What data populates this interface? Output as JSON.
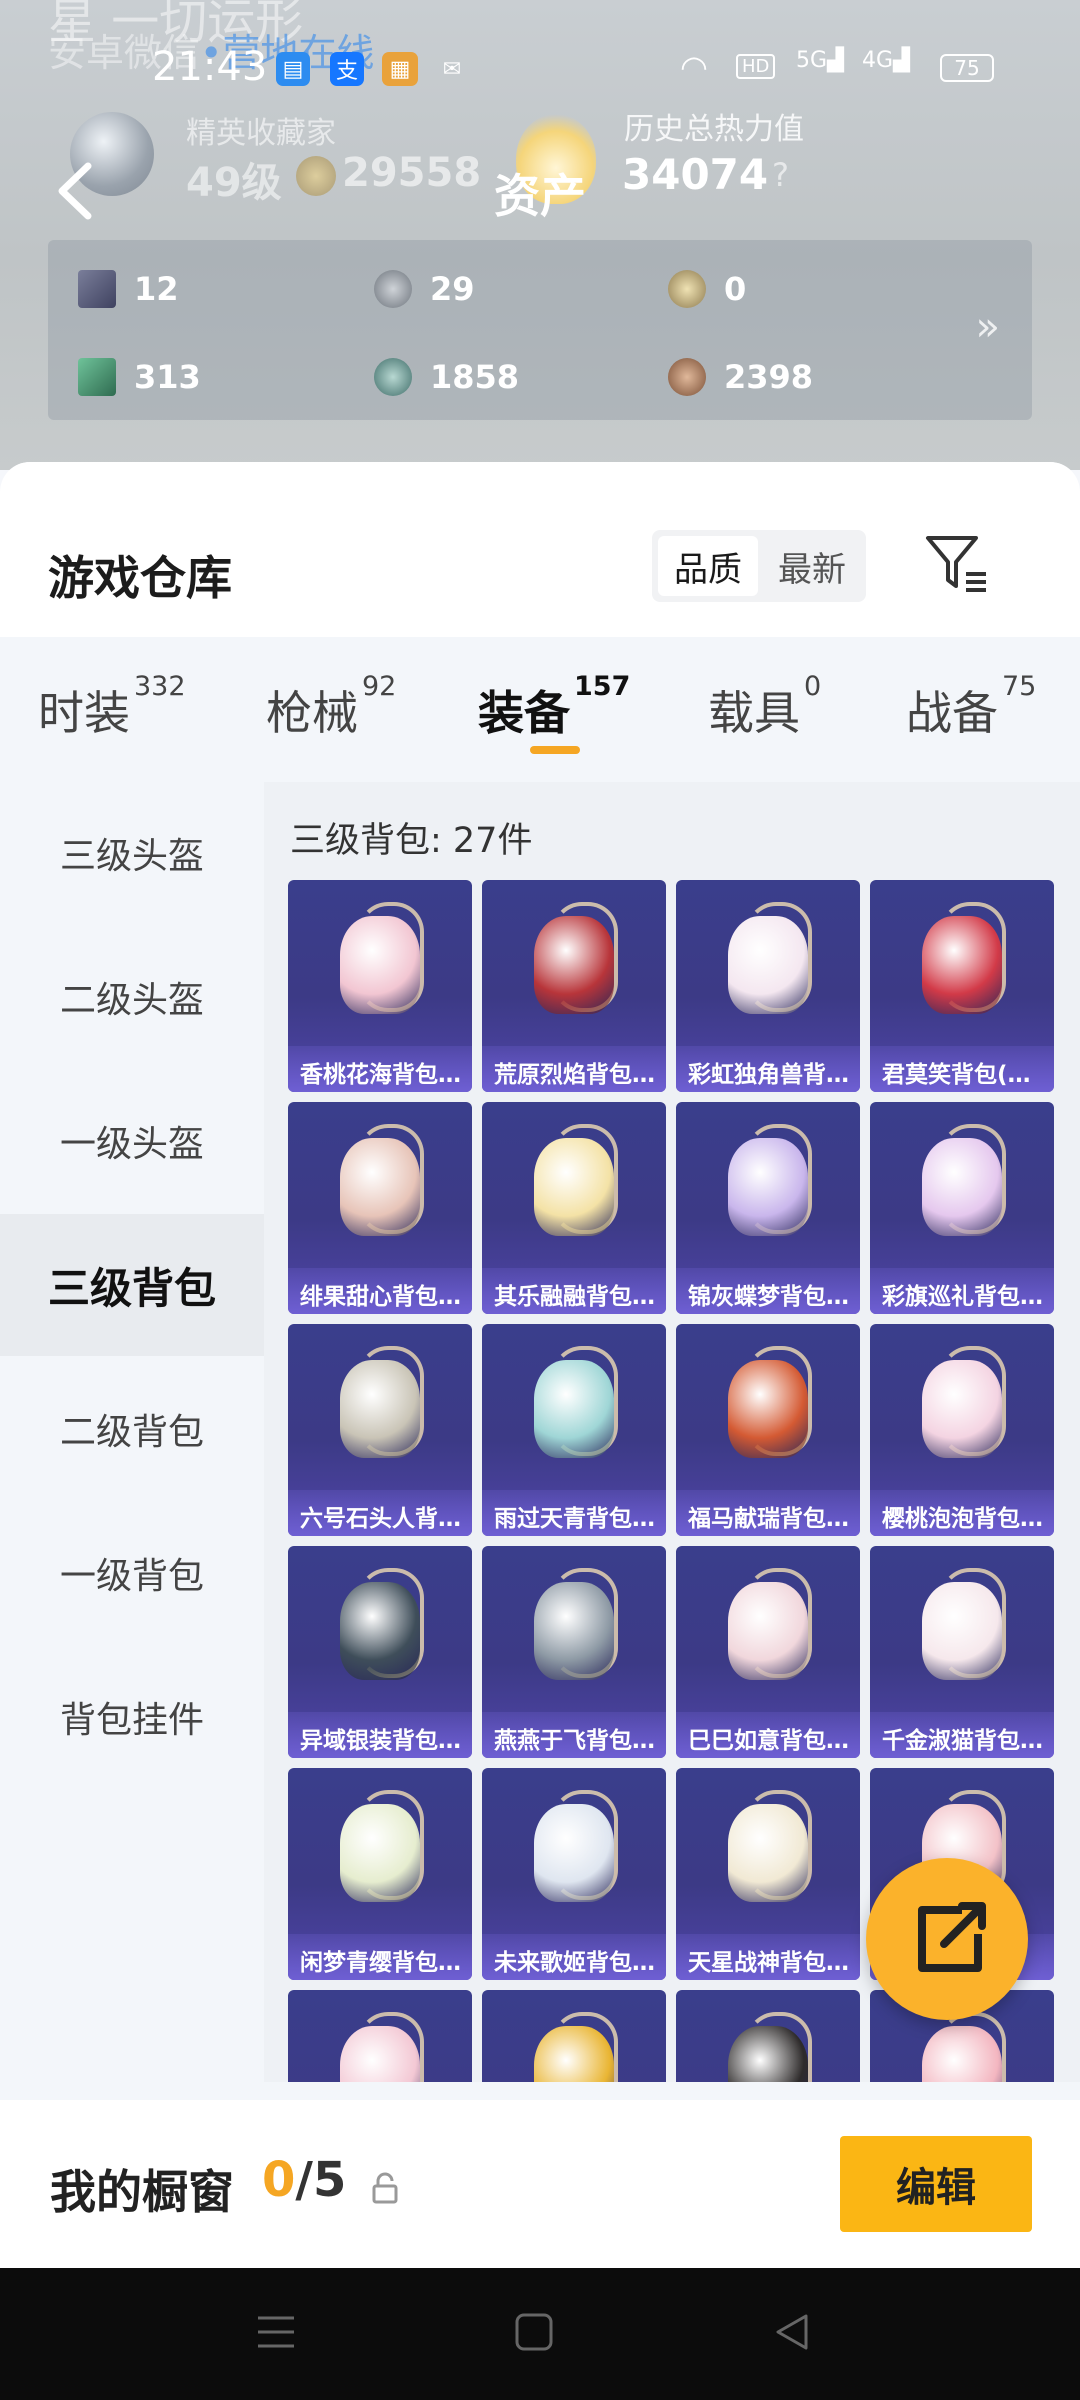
{
  "background_text": {
    "line0": "星 一切运形",
    "line1": "安卓微信",
    "line1_tag": "•营地在线"
  },
  "status_bar": {
    "time": "21:43",
    "hd": "HD",
    "sig1": "5G",
    "sig2": "4G",
    "battery": "75"
  },
  "header": {
    "title": "资产",
    "rank_label": "精英收藏家",
    "level": "49级",
    "points": "29558",
    "heat_label": "历史总热力值",
    "heat_value": "34074",
    "help": "?"
  },
  "resources": [
    {
      "icon": "card-icon",
      "value": "12"
    },
    {
      "icon": "silver-coin-icon",
      "value": "29"
    },
    {
      "icon": "gold-coin-icon",
      "value": "0"
    },
    {
      "icon": "green-card-icon",
      "value": "313"
    },
    {
      "icon": "teal-coin-icon",
      "value": "1858"
    },
    {
      "icon": "bronze-coin-icon",
      "value": "2398"
    }
  ],
  "warehouse": {
    "title": "游戏仓库",
    "sort": {
      "quality": "品质",
      "latest": "最新"
    }
  },
  "tabs": [
    {
      "label": "时装",
      "count": "332"
    },
    {
      "label": "枪械",
      "count": "92"
    },
    {
      "label": "装备",
      "count": "157",
      "active": true
    },
    {
      "label": "载具",
      "count": "0"
    },
    {
      "label": "战备",
      "count": "75"
    }
  ],
  "categories": [
    "三级头盔",
    "二级头盔",
    "一级头盔",
    "三级背包",
    "二级背包",
    "一级背包",
    "背包挂件"
  ],
  "content": {
    "title": "三级背包: 27件",
    "items": [
      "香桃花海背包...",
      "荒原烈焰背包...",
      "彩虹独角兽背...",
      "君莫笑背包(3...",
      "绯果甜心背包...",
      "其乐融融背包...",
      "锦灰蝶梦背包...",
      "彩旗巡礼背包...",
      "六号石头人背...",
      "雨过天青背包...",
      "福马献瑞背包...",
      "樱桃泡泡背包...",
      "异域银装背包...",
      "燕燕于飞背包...",
      "巳巳如意背包...",
      "千金淑猫背包...",
      "闲梦青缨背包...",
      "未来歌姬背包...",
      "天星战神背包...",
      "...",
      "",
      "",
      "",
      ""
    ]
  },
  "showcase": {
    "title": "我的橱窗",
    "used": "0",
    "total": "/5",
    "edit": "编辑"
  },
  "colors": {
    "accent": "#fbb614",
    "card": "#3c3a86"
  }
}
